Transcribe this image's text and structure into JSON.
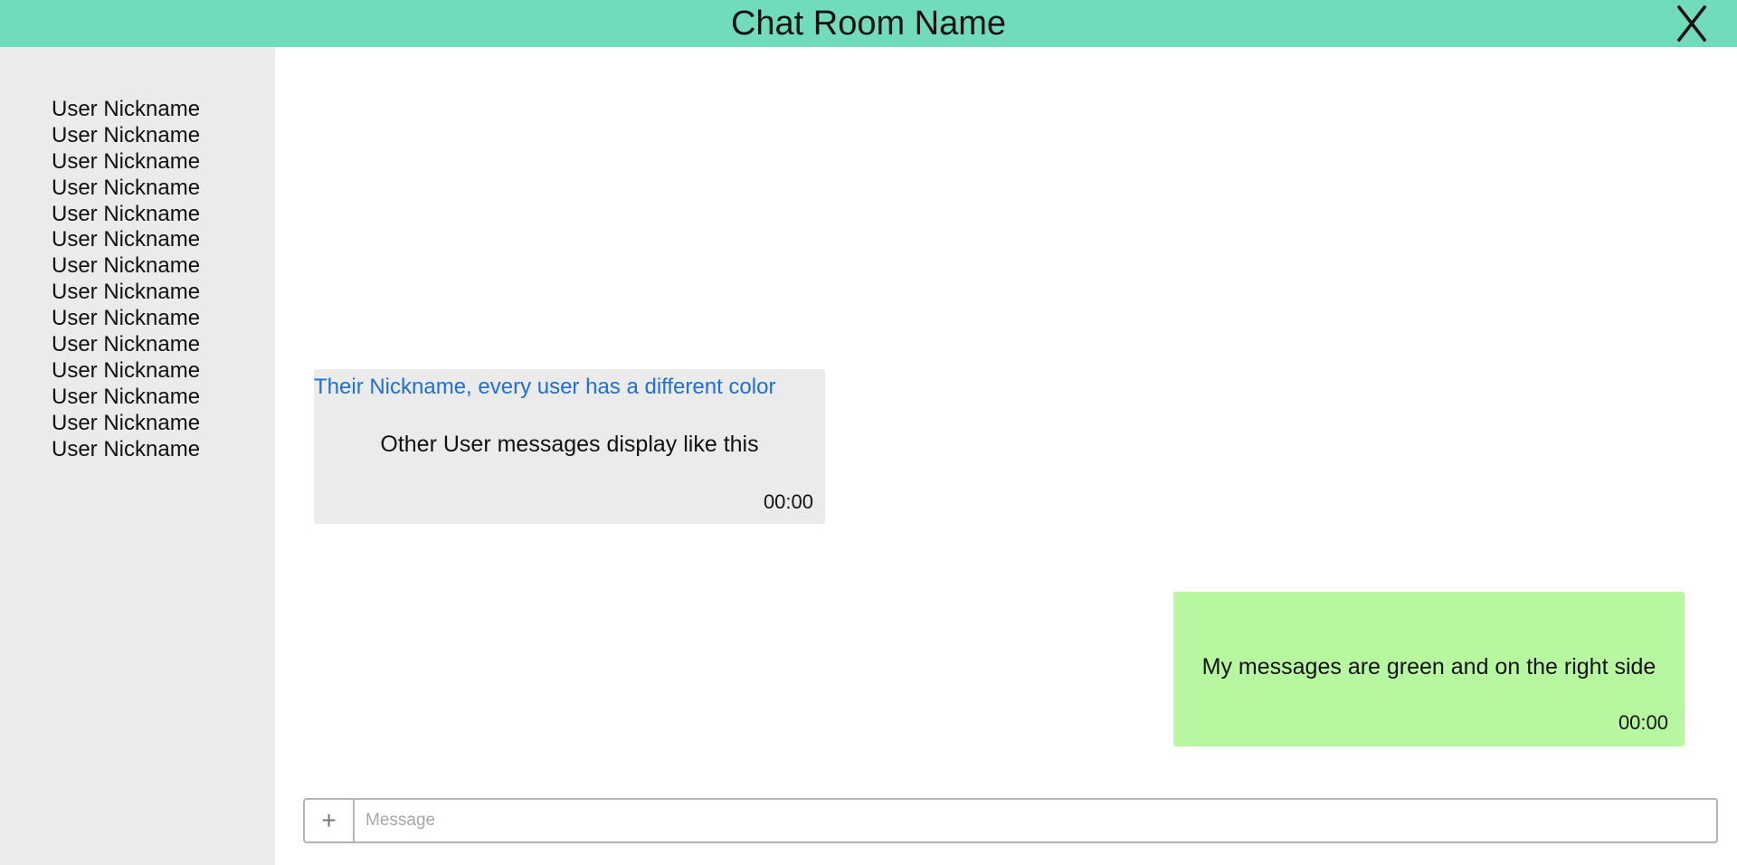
{
  "header": {
    "title": "Chat Room Name",
    "close_label": "X",
    "background_color": "#70dcbc"
  },
  "sidebar": {
    "background_color": "#ebebeb",
    "users": [
      "User Nickname",
      "User Nickname",
      "User Nickname",
      "User Nickname",
      "User Nickname",
      "User Nickname",
      "User Nickname",
      "User Nickname",
      "User Nickname",
      "User Nickname",
      "User Nickname",
      "User Nickname",
      "User Nickname",
      "User Nickname"
    ]
  },
  "messages": {
    "other": {
      "sender": "Their Nickname, every user has a different color",
      "text": "Other User messages display like this",
      "time": "00:00",
      "sender_color": "#1e6fd9",
      "bubble_color": "#ebebeb"
    },
    "mine": {
      "text": "My messages are green and on the right side",
      "time": "00:00",
      "bubble_color": "#b6f7a0"
    }
  },
  "composer": {
    "attach_icon": "plus-icon",
    "attach_label": "+",
    "placeholder": "Message",
    "value": ""
  }
}
